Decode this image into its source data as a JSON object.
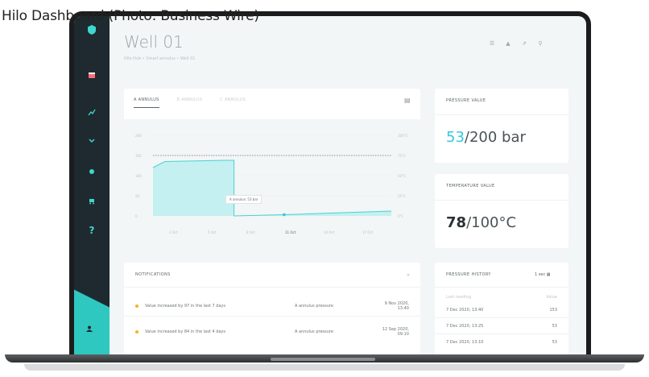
{
  "caption": "Hilo Dashboard (Photo: Business Wire)",
  "page": {
    "title": "Well 01",
    "breadcrumb": "Hilo Hub • Smart annulus • Well 01"
  },
  "top_icons": [
    "filter-icon",
    "grid-icon",
    "share-icon",
    "search-icon"
  ],
  "sidebar": {
    "icons": [
      "logo-icon",
      "calendar-icon",
      "chart-icon",
      "chevron-icon",
      "alert-icon",
      "cart-icon",
      "help-icon"
    ],
    "bottom": "user-icon"
  },
  "chart_card": {
    "tabs": [
      "A ANNULUS",
      "B ANNULUS",
      "C ANNULUS"
    ],
    "active_tab": "A ANNULUS",
    "tooltip": "A annulus: 53 bar"
  },
  "chart_data": {
    "type": "area",
    "x_ticks": [
      "2 Oct",
      "5 Oct",
      "8 Oct",
      "11 Oct",
      "14 Oct",
      "17 Oct"
    ],
    "y_ticks_left": [
      "200",
      "150",
      "100",
      "50",
      "0"
    ],
    "y_ticks_right": [
      "100°C",
      "75°C",
      "50°C",
      "25°C",
      "0°C"
    ],
    "points": [
      [
        0,
        120
      ],
      [
        0.05,
        135
      ],
      [
        0.3,
        138
      ],
      [
        0.34,
        138
      ],
      [
        0.34,
        0
      ],
      [
        0.55,
        3
      ],
      [
        1.0,
        12
      ]
    ],
    "max_line": 150,
    "ylim": [
      0,
      200
    ]
  },
  "pressure_card": {
    "label": "PRESSURE VALUE",
    "value": "53",
    "suffix": "/200 bar"
  },
  "temperature_card": {
    "label": "TEMPERATURE VALUE",
    "value": "78",
    "suffix": "/100°C"
  },
  "notifications": {
    "label": "NOTIFICATIONS",
    "rows": [
      {
        "message": "Value increased by 97 in the last 7 days",
        "source": "A annulus pressure",
        "date": "9 Nov 2020, 13:40"
      },
      {
        "message": "Value increased by 84 in the last 4 days",
        "source": "A annulus pressure",
        "date": "12 Sep 2020, 09:10"
      }
    ]
  },
  "history": {
    "label": "PRESSURE HISTORY",
    "filter": "1 sec",
    "header": {
      "col1": "Last reading",
      "col2": "Value"
    },
    "rows": [
      {
        "time": "7 Dec 2020, 13:40",
        "value": "153"
      },
      {
        "time": "7 Dec 2020, 13:25",
        "value": "53"
      },
      {
        "time": "7 Dec 2020, 13:10",
        "value": "53"
      }
    ]
  },
  "colors": {
    "sidebar": "#1e2a30",
    "accent": "#2ec8c0",
    "pressure_accent": "#34c8e0",
    "notification_dot": "#f5b323"
  }
}
